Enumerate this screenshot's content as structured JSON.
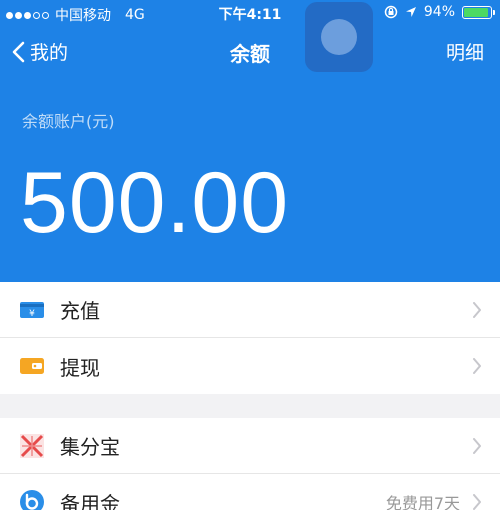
{
  "status_bar": {
    "carrier": "中国移动",
    "network": "4G",
    "time": "下午4:11",
    "battery_percent": "94%",
    "battery_level": 0.94
  },
  "nav": {
    "back_label": "我的",
    "title": "余额",
    "right_label": "明细"
  },
  "balance": {
    "label": "余额账户(元)",
    "value": "500.00"
  },
  "actions": [
    {
      "label": "充值",
      "icon": "wallet-card-icon"
    },
    {
      "label": "提现",
      "icon": "withdraw-wallet-icon"
    }
  ],
  "services": [
    {
      "label": "集分宝",
      "icon": "jifenbao-icon",
      "extra": ""
    },
    {
      "label": "备用金",
      "icon": "beiyongjin-icon",
      "extra": "免费用7天"
    }
  ],
  "colors": {
    "header_bg": "#1e82e6",
    "page_bg": "#f2f2f4",
    "battery_green": "#4cd964"
  }
}
